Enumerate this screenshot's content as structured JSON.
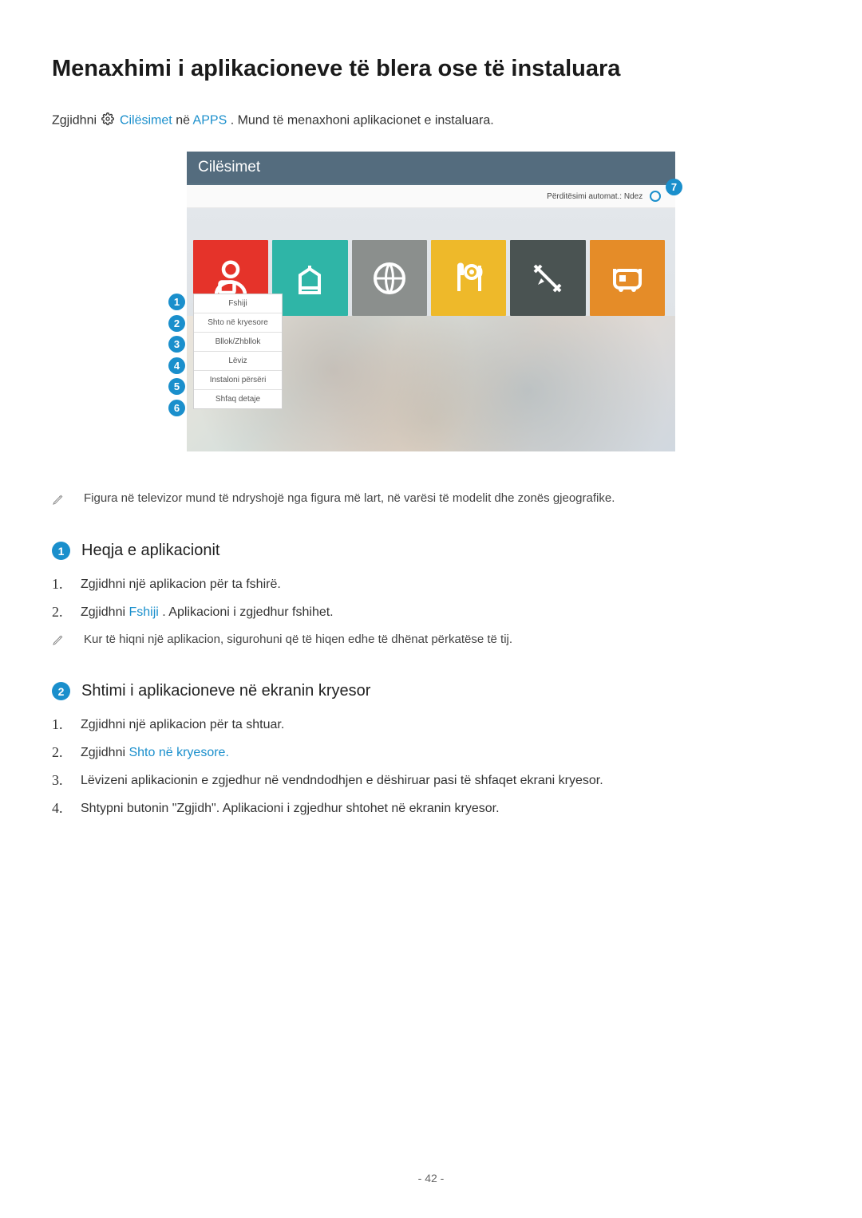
{
  "title": "Menaxhimi i aplikacioneve të blera ose të instaluara",
  "intro": {
    "prefix": "Zgjidhni ",
    "settings_link": "Cilësimet",
    "mid": " në ",
    "apps_link": "APPS",
    "suffix": ". Mund të menaxhoni aplikacionet e instaluara."
  },
  "screenshot": {
    "titlebar": "Cilësimet",
    "auto_update_label": "Përditësimi automat.: Ndez",
    "dropdown": [
      "Fshiji",
      "Shto në kryesore",
      "Bllok/Zhbllok",
      "Lëviz",
      "Instaloni përsëri",
      "Shfaq detaje"
    ],
    "badge_numbers": [
      "1",
      "2",
      "3",
      "4",
      "5",
      "6"
    ],
    "badge_7": "7"
  },
  "note_figure": "Figura në televizor mund të ndryshojë nga figura më lart, në varësi të modelit dhe zonës gjeografike.",
  "section1": {
    "badge": "1",
    "title": "Heqja e aplikacionit",
    "item1_num": "1.",
    "item1": "Zgjidhni një aplikacion për ta fshirë.",
    "item2_num": "2.",
    "item2_prefix": "Zgjidhni ",
    "item2_link": "Fshiji",
    "item2_suffix": ". Aplikacioni i zgjedhur fshihet.",
    "note": "Kur të hiqni një aplikacion, sigurohuni që të hiqen edhe të dhënat përkatëse të tij."
  },
  "section2": {
    "badge": "2",
    "title": "Shtimi i aplikacioneve në ekranin kryesor",
    "item1_num": "1.",
    "item1": "Zgjidhni një aplikacion për ta shtuar.",
    "item2_num": "2.",
    "item2_prefix": "Zgjidhni ",
    "item2_link": "Shto në kryesore.",
    "item3_num": "3.",
    "item3": "Lëvizeni aplikacionin e zgjedhur në vendndodhjen e dëshiruar pasi të shfaqet ekrani kryesor.",
    "item4_num": "4.",
    "item4": "Shtypni butonin \"Zgjidh\". Aplikacioni i zgjedhur shtohet në ekranin kryesor."
  },
  "pagenum": "- 42 -"
}
